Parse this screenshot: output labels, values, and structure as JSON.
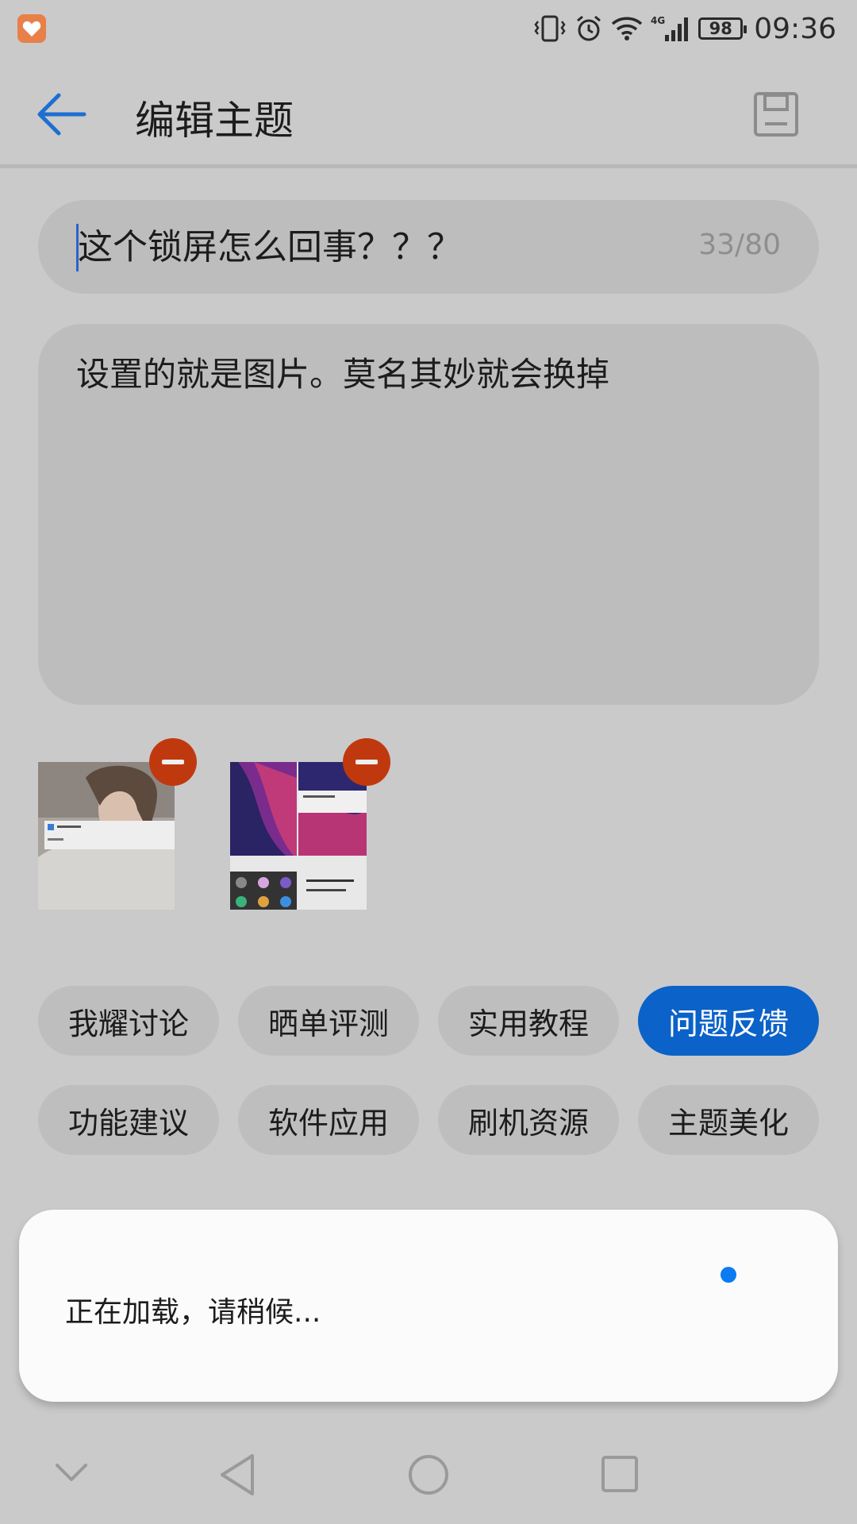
{
  "status_bar": {
    "time": "09:36",
    "battery": "98",
    "network": "4G"
  },
  "toolbar": {
    "title": "编辑主题"
  },
  "post": {
    "title_value": "这个锁屏怎么回事？？？",
    "title_counter": "33/80",
    "body_value": "设置的就是图片。莫名其妙就会换掉"
  },
  "categories": [
    {
      "label": "我耀讨论",
      "selected": false
    },
    {
      "label": "晒单评测",
      "selected": false
    },
    {
      "label": "实用教程",
      "selected": false
    },
    {
      "label": "问题反馈",
      "selected": true
    },
    {
      "label": "功能建议",
      "selected": false
    },
    {
      "label": "软件应用",
      "selected": false
    },
    {
      "label": "刷机资源",
      "selected": false
    },
    {
      "label": "主题美化",
      "selected": false
    }
  ],
  "dialog": {
    "message": "正在加载，请稍候..."
  },
  "colors": {
    "accent": "#0b62c8",
    "remove_badge": "#c0390e",
    "spinner": "#0a7bf0"
  },
  "icons": [
    "back-arrow-icon",
    "save-draft-icon",
    "remove-image-icon",
    "nav-down-icon",
    "nav-back-icon",
    "nav-home-icon",
    "nav-recents-icon"
  ]
}
